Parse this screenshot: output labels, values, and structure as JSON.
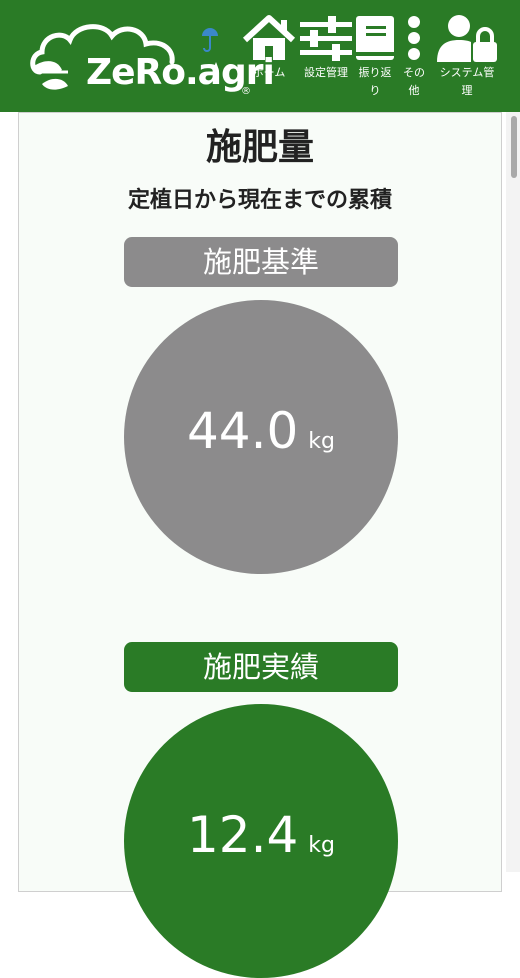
{
  "app": {
    "logo_text": "ZeRo.agri",
    "logo_mark": "®"
  },
  "nav": [
    {
      "label": "ホーム",
      "icon": "home-icon"
    },
    {
      "label": "設定管理",
      "icon": "sliders-icon"
    },
    {
      "label": "振り返り",
      "icon": "book-icon"
    },
    {
      "label": "その他",
      "icon": "more-icon"
    },
    {
      "label": "システム管理",
      "icon": "user-lock-icon"
    }
  ],
  "page": {
    "title": "施肥量",
    "subtitle": "定植日から現在までの累積"
  },
  "standard": {
    "label": "施肥基準",
    "value": "44.0",
    "unit": "kg",
    "color": "#8c8b8c"
  },
  "actual": {
    "label": "施肥実績",
    "value": "12.4",
    "unit": "kg",
    "color": "#2a7b26"
  },
  "colors": {
    "header": "#2a7b26",
    "umbrella": "#3b88c8"
  }
}
